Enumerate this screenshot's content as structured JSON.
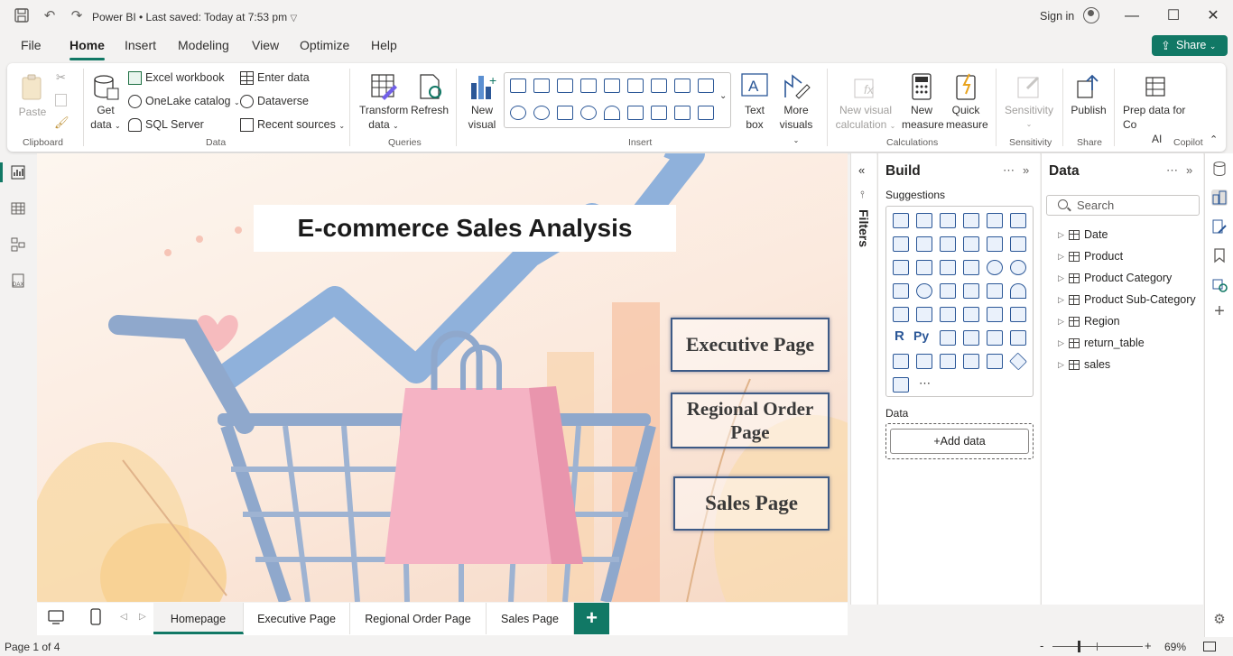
{
  "app": {
    "title": "Power BI • Last saved: Today at 7:53 pm",
    "sign_in": "Sign in",
    "share": "Share"
  },
  "menu": [
    "File",
    "Home",
    "Insert",
    "Modeling",
    "View",
    "Optimize",
    "Help"
  ],
  "ribbon": {
    "paste": "Paste",
    "clipboard": "Clipboard",
    "get_data": "Get",
    "get_data2": "data",
    "excel": "Excel workbook",
    "onelake": "OneLake catalog",
    "sql": "SQL Server",
    "enter_data": "Enter data",
    "dataverse": "Dataverse",
    "recent": "Recent sources",
    "data_group": "Data",
    "transform": "Transform",
    "transform2": "data",
    "refresh": "Refresh",
    "queries": "Queries",
    "new_visual": "New",
    "new_visual2": "visual",
    "insert_group": "Insert",
    "text_box": "Text",
    "text_box2": "box",
    "more_visuals": "More",
    "more_visuals2": "visuals",
    "new_calc": "New visual",
    "new_calc2": "calculation",
    "new_measure": "New",
    "new_measure2": "measure",
    "quick_measure": "Quick",
    "quick_measure2": "measure",
    "calculations": "Calculations",
    "sensitivity": "Sensitivity",
    "sensitivity_group": "Sensitivity",
    "publish": "Publish",
    "share_group": "Share",
    "prep": "Prep data for Co",
    "prep2": "AI",
    "copilot": "Copilot"
  },
  "canvas": {
    "title": "E-commerce Sales Analysis",
    "btn_exec": "Executive Page",
    "btn_regional": "Regional Order Page",
    "btn_sales": "Sales Page"
  },
  "filters": {
    "label": "Filters"
  },
  "build": {
    "title": "Build",
    "suggestions": "Suggestions",
    "data_label": "Data",
    "add_data": "+Add data"
  },
  "data_pane": {
    "title": "Data",
    "search_placeholder": "Search",
    "tables": [
      "Date",
      "Product",
      "Product Category",
      "Product Sub-Category",
      "Region",
      "return_table",
      "sales"
    ]
  },
  "tabs": [
    "Homepage",
    "Executive Page",
    "Regional Order Page",
    "Sales Page"
  ],
  "status": {
    "page": "Page 1 of 4",
    "zoom": "69%"
  }
}
